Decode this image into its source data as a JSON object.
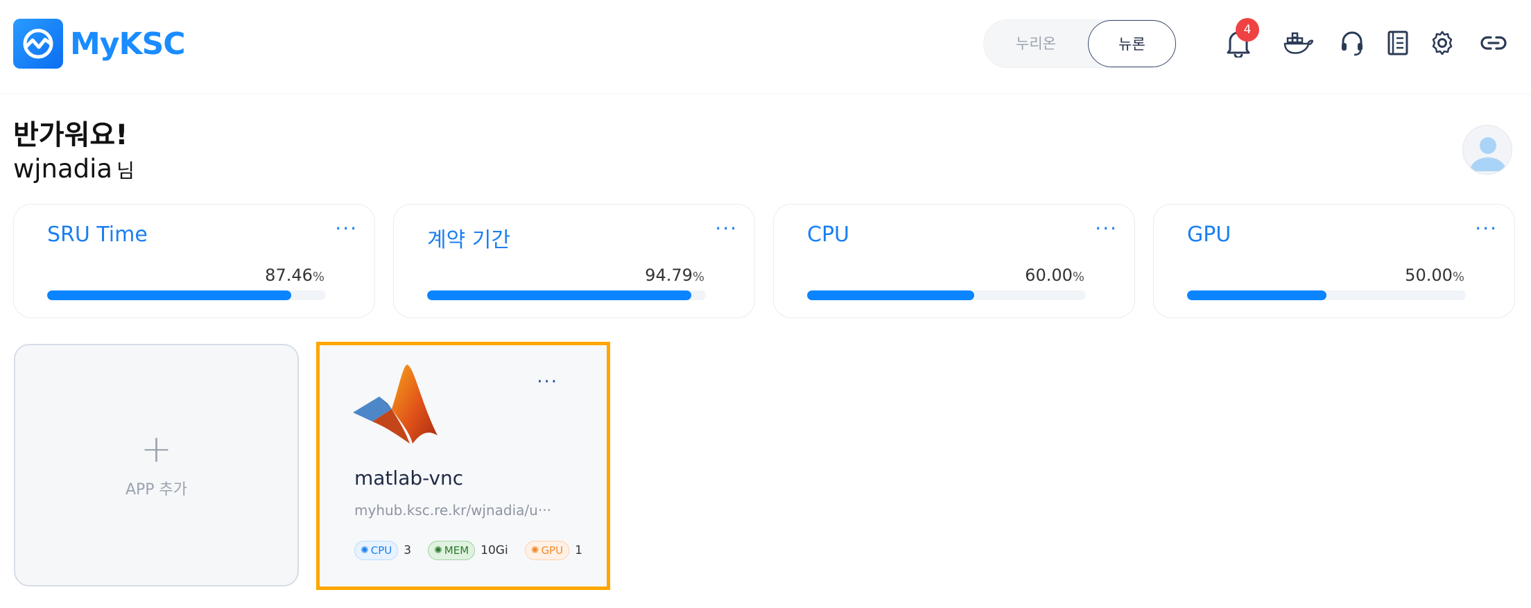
{
  "header": {
    "logo_text": "MyKSC",
    "toggle": {
      "left": "누리온",
      "right": "뉴론",
      "selected": "뉴론"
    },
    "notifications": {
      "count": "4"
    },
    "icons": [
      "bell-icon",
      "docker-icon",
      "headset-icon",
      "notebook-icon",
      "gear-icon",
      "link-icon"
    ]
  },
  "greeting": {
    "line1": "반가워요!",
    "username": "wjnadia",
    "suffix": "님"
  },
  "stats": [
    {
      "title": "SRU Time",
      "value": "87.46",
      "unit": "%",
      "progress": 87.46
    },
    {
      "title": "계약 기간",
      "value": "94.79",
      "unit": "%",
      "progress": 94.79
    },
    {
      "title": "CPU",
      "value": "60.00",
      "unit": "%",
      "progress": 60.0
    },
    {
      "title": "GPU",
      "value": "50.00",
      "unit": "%",
      "progress": 50.0
    }
  ],
  "more_label": "···",
  "add_app": {
    "plus": "+",
    "label": "APP 추가"
  },
  "app": {
    "name": "matlab-vnc",
    "url": "myhub.ksc.re.kr/wjnadia/u···",
    "resources": {
      "cpu": {
        "label": "CPU",
        "value": "3"
      },
      "mem": {
        "label": "MEM",
        "value": "10Gi"
      },
      "gpu": {
        "label": "GPU",
        "value": "1"
      }
    }
  },
  "colors": {
    "accent": "#1a7ff0",
    "highlight": "#ffa600",
    "badge": "#ef4343"
  }
}
